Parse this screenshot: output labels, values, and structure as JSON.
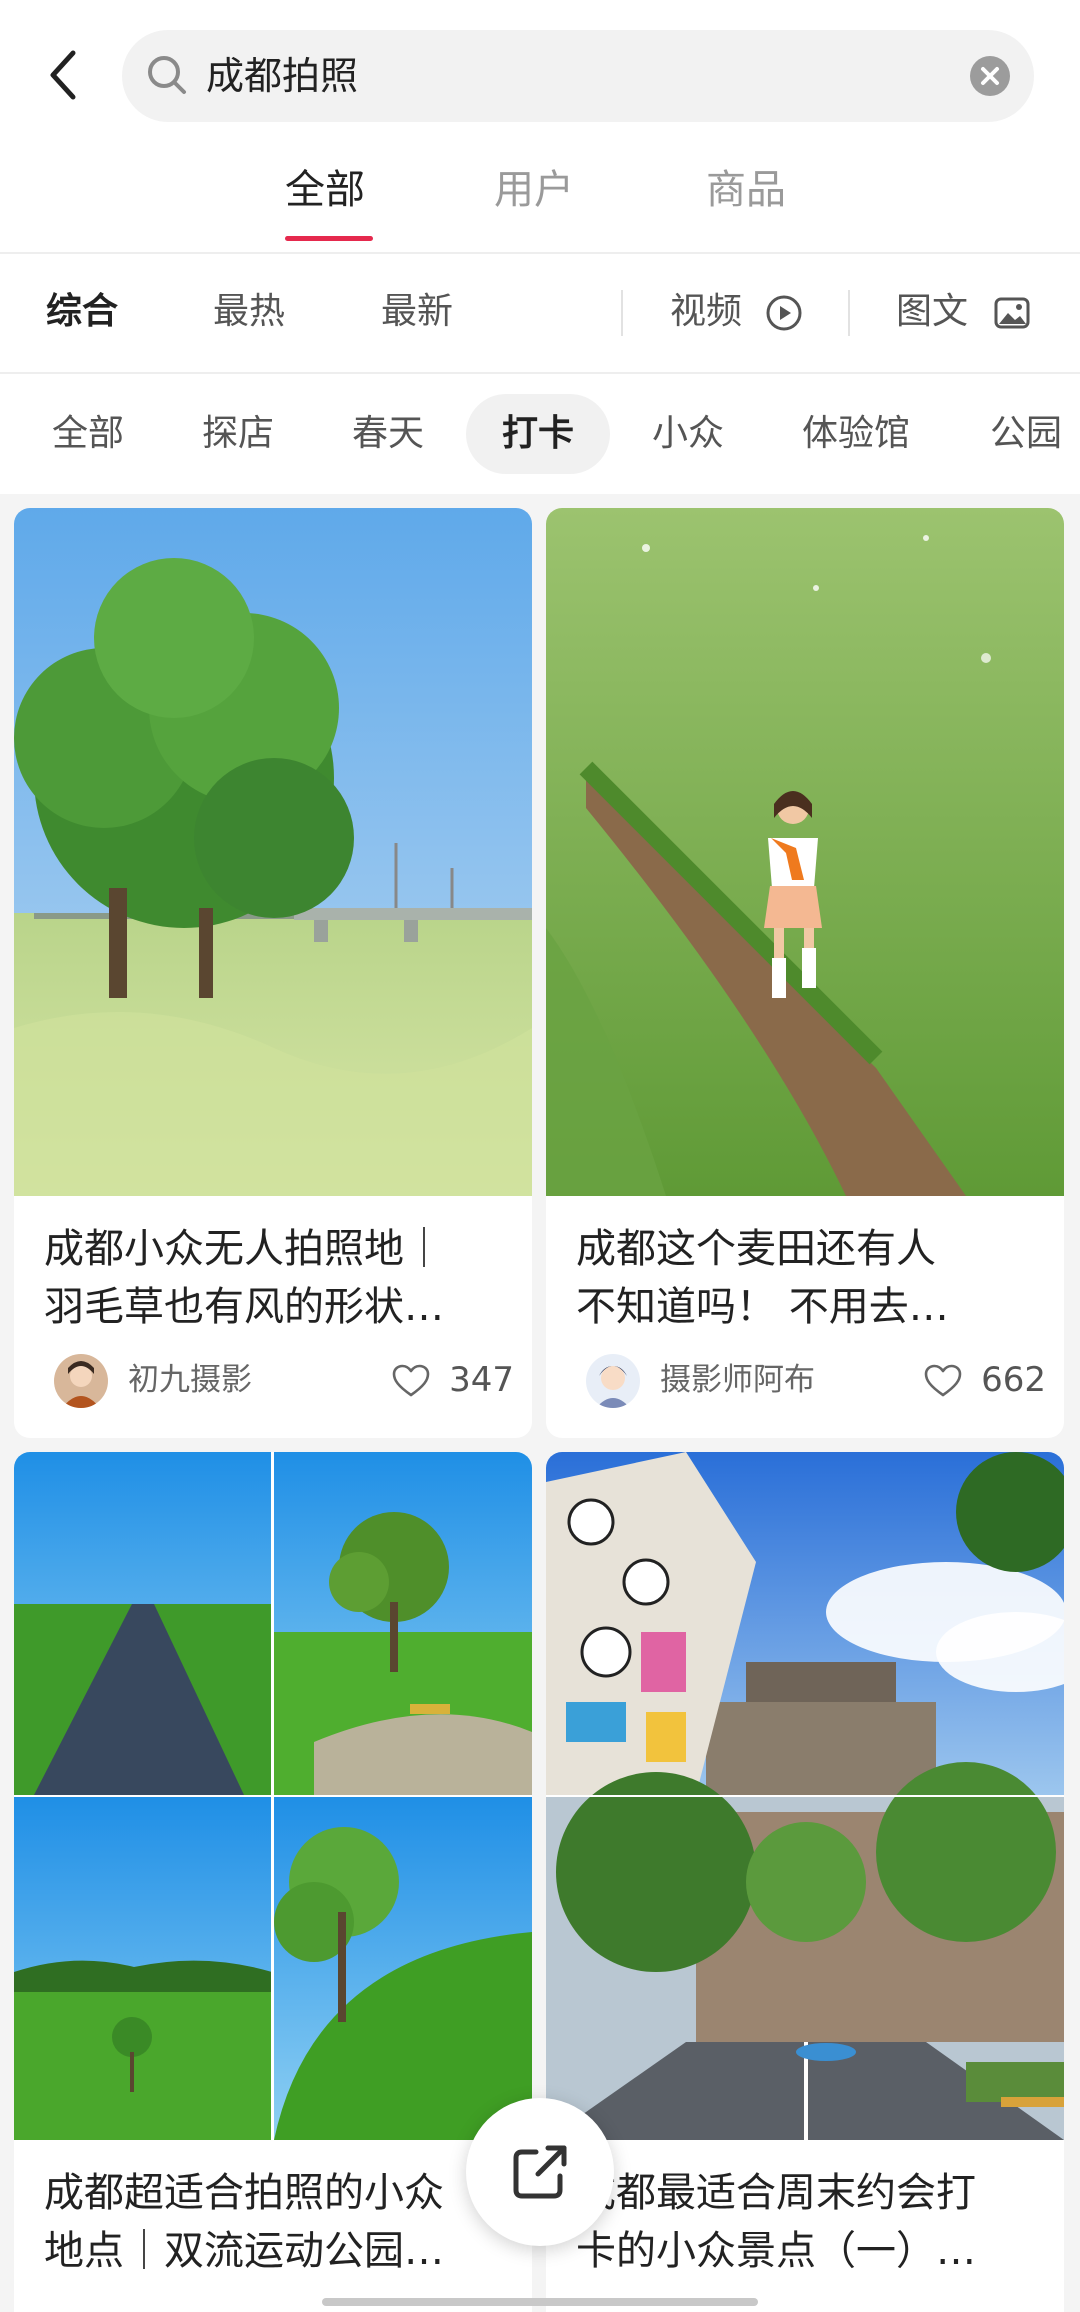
{
  "search": {
    "query": "成都拍照"
  },
  "tabs": [
    {
      "label": "全部",
      "active": true
    },
    {
      "label": "用户",
      "active": false
    },
    {
      "label": "商品",
      "active": false
    }
  ],
  "sort": {
    "comprehensive": "综合",
    "hot": "最热",
    "latest": "最新",
    "video": "视频",
    "image_text": "图文"
  },
  "chips": [
    "全部",
    "探店",
    "春天",
    "打卡",
    "小众",
    "体验馆",
    "公园"
  ],
  "active_chip": "打卡",
  "posts": [
    {
      "title_line1": "成都小众无人拍照地｜",
      "title_line2": "羽毛草也有风的形状…",
      "author": "初九摄影",
      "likes": "347"
    },
    {
      "title_line1": "成都这个麦田还有人",
      "title_line2": "不知道吗！ 不用去…",
      "author": "摄影师阿布",
      "likes": "662"
    },
    {
      "title_line1": "成都超适合拍照的小众",
      "title_line2": "地点｜双流运动公园…"
    },
    {
      "title_line1": "成都最适合周末约会打",
      "title_line2": "卡的小众景点（一）…"
    }
  ],
  "colors": {
    "accent": "#e5294d"
  }
}
